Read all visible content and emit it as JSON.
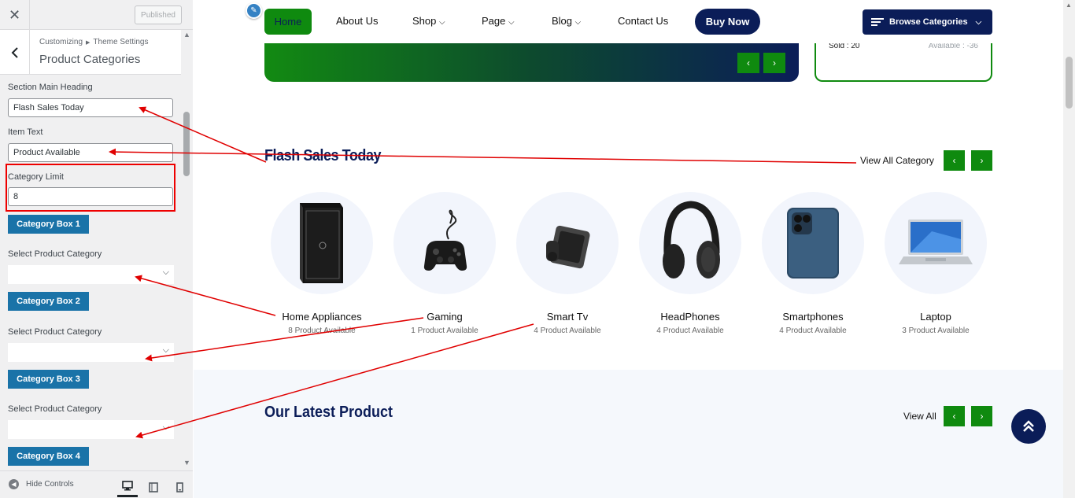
{
  "customizer": {
    "close_icon": "close-icon",
    "publish_label": "Published",
    "breadcrumb": {
      "root": "Customizing",
      "parent": "Theme Settings"
    },
    "panel_title": "Product Categories",
    "fields": {
      "heading_label": "Section Main Heading",
      "heading_value": "Flash Sales Today",
      "item_text_label": "Item Text",
      "item_text_value": "Product Available",
      "limit_label": "Category Limit",
      "limit_value": "8"
    },
    "category_boxes": [
      {
        "button": "Category Box 1",
        "select_label": "Select Product Category",
        "selected": ""
      },
      {
        "button": "Category Box 2",
        "select_label": "Select Product Category",
        "selected": ""
      },
      {
        "button": "Category Box 3",
        "select_label": "Select Product Category",
        "selected": ""
      },
      {
        "button": "Category Box 4"
      }
    ],
    "footer": {
      "hide_controls": "Hide Controls",
      "devices": [
        "desktop-icon",
        "tablet-icon",
        "mobile-icon"
      ]
    }
  },
  "site": {
    "nav": {
      "home": "Home",
      "about": "About Us",
      "shop": "Shop",
      "page": "Page",
      "blog": "Blog",
      "contact": "Contact Us",
      "buy_now": "Buy Now",
      "browse": "Browse Categories"
    },
    "deal_card": {
      "sold": "Sold : 20",
      "available": "Available : -36"
    },
    "flash": {
      "heading": "Flash Sales Today",
      "view_all": "View All Category",
      "categories": [
        {
          "name": "Home Appliances",
          "count": "8 Product Available",
          "image": "pc-tower"
        },
        {
          "name": "Gaming",
          "count": "1 Product Available",
          "image": "gamepad"
        },
        {
          "name": "Smart Tv",
          "count": "4 Product Available",
          "image": "smartwatch"
        },
        {
          "name": "HeadPhones",
          "count": "4 Product Available",
          "image": "headphones"
        },
        {
          "name": "Smartphones",
          "count": "4 Product Available",
          "image": "smartphone"
        },
        {
          "name": "Laptop",
          "count": "3 Product Available",
          "image": "laptop"
        }
      ]
    },
    "latest": {
      "heading": "Our Latest Product",
      "view_all": "View All"
    }
  },
  "colors": {
    "brand_green": "#0f8a0f",
    "brand_navy": "#0b1d58",
    "wp_blue": "#1a73a8",
    "annotation_red": "#e00000"
  }
}
